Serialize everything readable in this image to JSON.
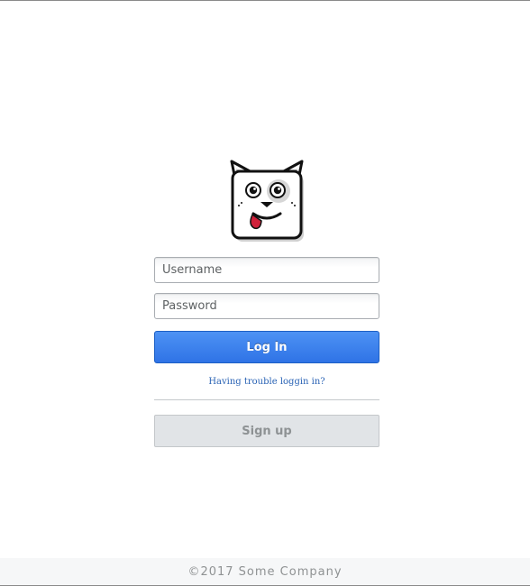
{
  "login_form": {
    "username_placeholder": "Username",
    "password_placeholder": "Password",
    "login_label": "Log In",
    "trouble_link": "Having trouble loggin in?",
    "signup_label": "Sign up"
  },
  "footer": {
    "copyright": "©2017 Some Company"
  },
  "logo": {
    "icon": "dog-mascot-icon"
  },
  "colors": {
    "primary_button": "#3a7ff0",
    "link": "#2a63b5",
    "signup_button": "#e1e4e7",
    "footer_background": "#f6f7f8",
    "tongue": "#d0203a"
  }
}
